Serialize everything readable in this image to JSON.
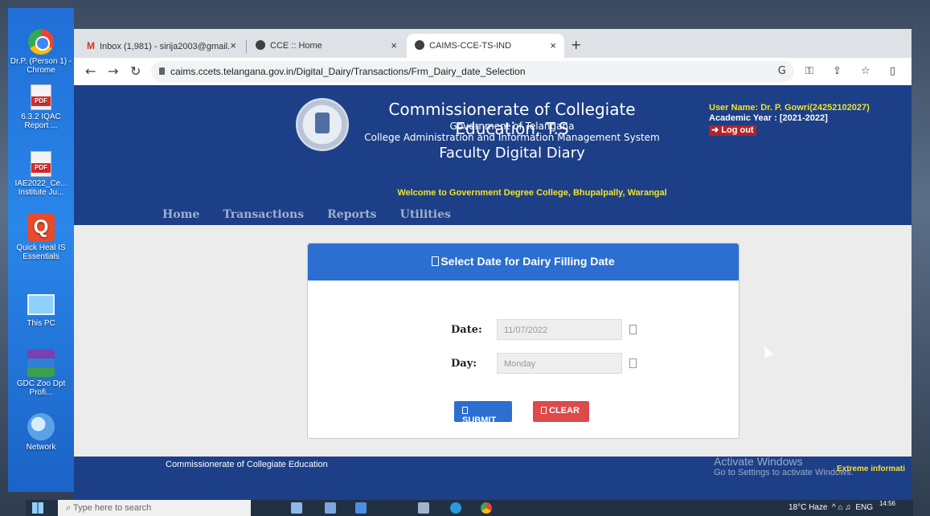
{
  "desktop": {
    "icons": [
      {
        "label": "Dr.P. (Person 1) - Chrome",
        "icon": "chrome-icon"
      },
      {
        "label": "6.3.2 IQAC Report ...",
        "icon": "pdf-icon"
      },
      {
        "label": "IAE2022_Ce... Institute Ju...",
        "icon": "pdf-icon"
      },
      {
        "label": "Quick Heal IS Essentials",
        "icon": "quick-heal-icon"
      },
      {
        "label": "This PC",
        "icon": "this-pc-icon"
      },
      {
        "label": "GDC Zoo Dpt Profi...",
        "icon": "winrar-icon"
      },
      {
        "label": "Network",
        "icon": "network-icon"
      }
    ]
  },
  "browser": {
    "tabs": [
      {
        "title": "Inbox (1,981) - sirija2003@gmail.",
        "icon": "gmail-icon"
      },
      {
        "title": "CCE :: Home",
        "icon": "globe-icon"
      },
      {
        "title": "CAIMS-CCE-TS-IND",
        "icon": "globe-icon",
        "active": true
      }
    ],
    "url": "caims.ccets.telangana.gov.in/Digital_Dairy/Transactions/Frm_Dairy_date_Selection"
  },
  "header": {
    "title": "Commissionerate of Collegiate Education, T.S",
    "subtitle1": "Government of Telangana",
    "subtitle2": "College Administration and Information Management System",
    "subtitle3": "Faculty Digital Diary",
    "welcome": "Welcome to  Government Degree College, Bhupalpally, Warangal",
    "user_name": "User Name:  Dr. P. Gowri(24252102027)",
    "academic_year": "Academic Year : [2021-2022]",
    "logout": "Log out"
  },
  "nav": {
    "items": [
      "Home",
      "Transactions",
      "Reports",
      "Utilities"
    ]
  },
  "form": {
    "heading": "Select Date for Dairy Filling Date",
    "date_label": "Date:",
    "date_value": "11/07/2022",
    "day_label": "Day:",
    "day_value": "Monday",
    "submit_label": "SUBMIT",
    "clear_label": "CLEAR"
  },
  "footer": {
    "left": "Commissionerate of Collegiate Education",
    "right": "Extreme informati"
  },
  "watermark": {
    "line1": "Activate Windows",
    "line2": "Go to Settings to activate Windows."
  },
  "taskbar": {
    "search_placeholder": "Type here to search",
    "weather": "18°C  Haze",
    "lang": "ENG",
    "time": "14:56"
  },
  "colors": {
    "header_blue": "#1c3f87",
    "panel_blue": "#2c6fd0",
    "accent_yellow": "#f2e229",
    "clear_red": "#de4949"
  }
}
